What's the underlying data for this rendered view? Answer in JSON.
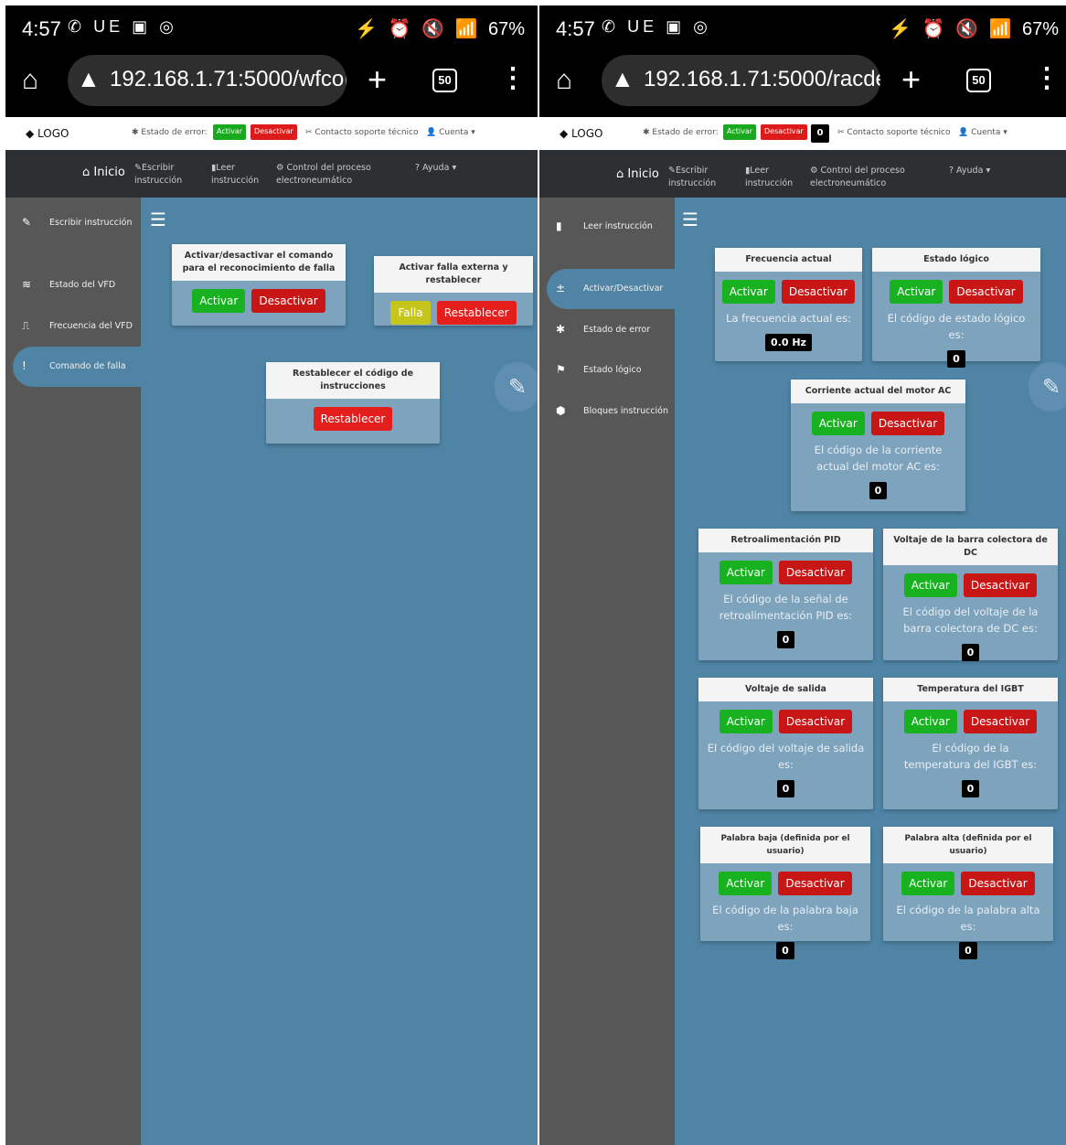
{
  "statusbar": {
    "time": "4:57",
    "left_icons": "✆ UE ▣ ◎",
    "right_icons": [
      "⚡",
      "⏰",
      "🔇",
      "📶",
      "67%"
    ],
    "battery": "67%"
  },
  "browser_left": {
    "url": "192.168.1.71:5000/wfcoı",
    "tab_count": "50"
  },
  "browser_right": {
    "url": "192.168.1.71:5000/racde",
    "tab_count": "50"
  },
  "topbar": {
    "logo": "LOGO",
    "error_label": "Estado de error:",
    "activate": "Activar",
    "deactivate": "Desactivar",
    "counter": "0",
    "contact": "Contacto soporte técnico",
    "account": "Cuenta"
  },
  "navbar": {
    "home": "Inicio",
    "write": [
      "Escribir",
      "instrucción"
    ],
    "read": [
      "Leer",
      "instrucción"
    ],
    "control": [
      "Control del proceso",
      "electroneumático"
    ],
    "help": "? Ayuda"
  },
  "sidebar_left": [
    {
      "icon": "✎",
      "label": "Escribir instrucción"
    },
    {
      "icon": "≋",
      "label": "Estado del VFD"
    },
    {
      "icon": "⎍",
      "label": "Frecuencia del VFD"
    },
    {
      "icon": "!",
      "label": "Comando de falla"
    }
  ],
  "sidebar_right": [
    {
      "icon": "▮",
      "label": "Leer instrucción"
    },
    {
      "icon": "±",
      "label": "Activar/Desactivar"
    },
    {
      "icon": "✱",
      "label": "Estado de error"
    },
    {
      "icon": "⚑",
      "label": "Estado lógico"
    },
    {
      "icon": "⬢",
      "label": "Bloques instrucción"
    }
  ],
  "left_cards": {
    "c1": {
      "title": "Activar/desactivar el comando para el reconocimiento de falla",
      "b1": "Activar",
      "b2": "Desactivar"
    },
    "c2": {
      "title": "Activar falla externa y restablecer",
      "b1": "Falla",
      "b2": "Restablecer"
    },
    "c3": {
      "title": "Restablecer el código de instrucciones",
      "b1": "Restablecer"
    }
  },
  "right_cards": [
    {
      "title": "Frecuencia actual",
      "desc": "La frecuencia actual es:",
      "value": "0.0 Hz"
    },
    {
      "title": "Estado lógico",
      "desc": "El código de estado lógico es:",
      "value": "0"
    },
    {
      "title": "Corriente actual del motor AC",
      "desc": "El código de la corriente actual del motor AC es:",
      "value": "0"
    },
    {
      "title": "Retroalimentación PID",
      "desc": "El código de la señal de retroalimentación PID es:",
      "value": "0"
    },
    {
      "title": "Voltaje de la barra colectora de DC",
      "desc": "El código del voltaje de la barra colectora de DC es:",
      "value": "0"
    },
    {
      "title": "Voltaje de salida",
      "desc": "El código del voltaje de salida es:",
      "value": "0"
    },
    {
      "title": "Temperatura del IGBT",
      "desc": "El código de la temperatura del IGBT es:",
      "value": "0"
    },
    {
      "title": "Palabra baja (definida por el usuario)",
      "desc": "El código de la palabra baja es:",
      "value": "0"
    },
    {
      "title": "Palabra alta (definida por el usuario)",
      "desc": "El código de la palabra alta es:",
      "value": "0"
    }
  ],
  "buttons": {
    "activate": "Activar",
    "deactivate": "Desactivar"
  }
}
